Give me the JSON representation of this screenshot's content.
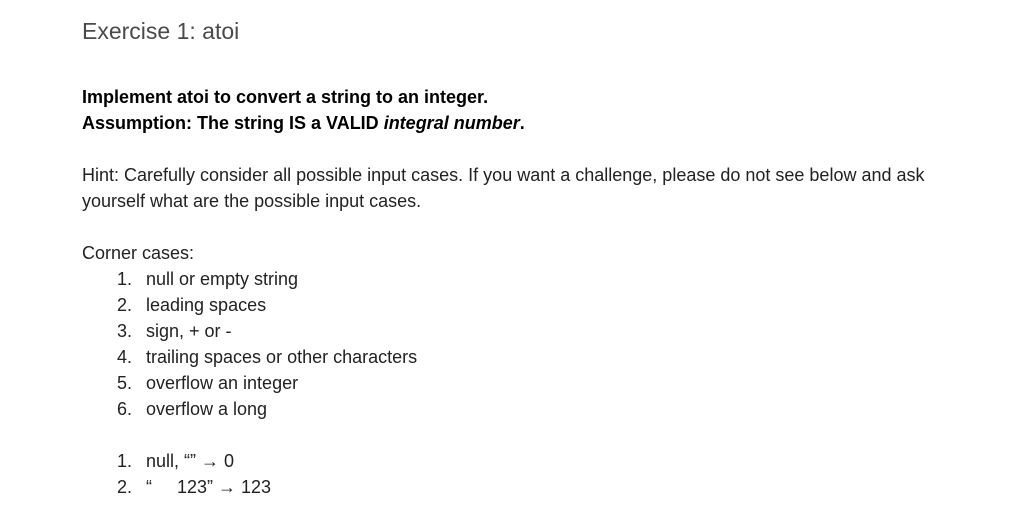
{
  "title": "Exercise 1: atoi",
  "statement": {
    "line1": "Implement atoi to convert a string to an integer.",
    "line2_prefix": "Assumption: The string IS a VALID ",
    "line2_italic": "integral number",
    "line2_suffix": "."
  },
  "hint": "Hint: Carefully consider all possible input cases. If you want a challenge, please do not see below and ask yourself what are the possible input cases.",
  "corner_cases": {
    "heading": "Corner cases:",
    "items": [
      {
        "num": "1.",
        "text": "null or empty string"
      },
      {
        "num": "2.",
        "text": "leading spaces"
      },
      {
        "num": "3.",
        "text": "sign, + or -"
      },
      {
        "num": "4.",
        "text": "trailing spaces or other characters"
      },
      {
        "num": "5.",
        "text": "overflow an integer"
      },
      {
        "num": "6.",
        "text": "overflow a long"
      }
    ]
  },
  "examples": [
    {
      "num": "1.",
      "text": "null, “” → 0"
    },
    {
      "num": "2.",
      "text": "“     123” → 123"
    }
  ]
}
